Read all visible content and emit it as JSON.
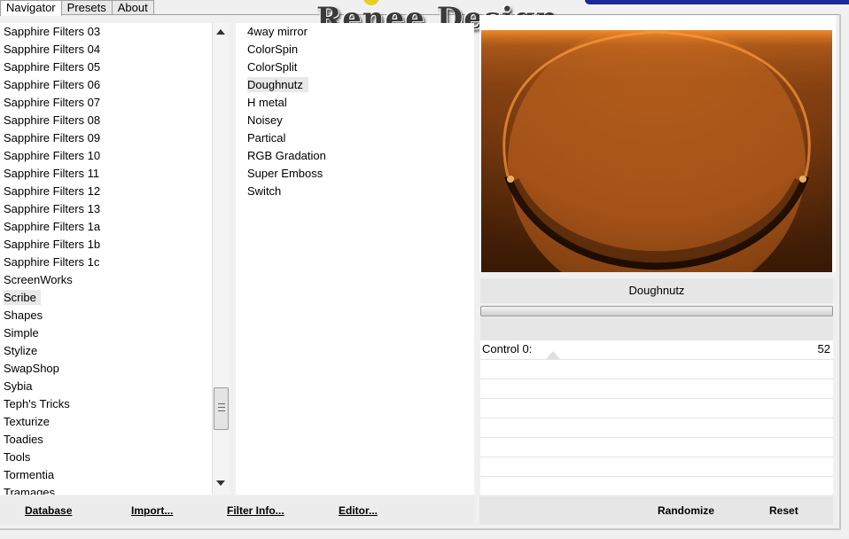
{
  "tabs": [
    {
      "label": "Navigator",
      "active": true
    },
    {
      "label": "Presets",
      "active": false
    },
    {
      "label": "About",
      "active": false
    }
  ],
  "logo_text": "Renee Design",
  "categories": [
    "Sapphire Filters 03",
    "Sapphire Filters 04",
    "Sapphire Filters 05",
    "Sapphire Filters 06",
    "Sapphire Filters 07",
    "Sapphire Filters 08",
    "Sapphire Filters 09",
    "Sapphire Filters 10",
    "Sapphire Filters 11",
    "Sapphire Filters 12",
    "Sapphire Filters 13",
    "Sapphire Filters 1a",
    "Sapphire Filters 1b",
    "Sapphire Filters 1c",
    "ScreenWorks",
    "Scribe",
    "Shapes",
    "Simple",
    "Stylize",
    "SwapShop",
    "Sybia",
    "Teph's Tricks",
    "Texturize",
    "Toadies",
    "Tools",
    "Tormentia",
    "Tramages"
  ],
  "selected_category": "Scribe",
  "filters": [
    "4way mirror",
    "ColorSpin",
    "ColorSplit",
    "Doughnutz",
    "H metal",
    "Noisey",
    "Partical",
    "RGB Gradation",
    "Super Emboss",
    "Switch"
  ],
  "selected_filter": "Doughnutz",
  "preview": {
    "filter_name": "Doughnutz",
    "colors": {
      "orange": "#f07f20",
      "dark": "#1a0a02",
      "mid": "#a8541c"
    }
  },
  "controls": [
    {
      "label": "Control 0:",
      "value": "52"
    }
  ],
  "buttons": {
    "database": "Database",
    "import": "Import...",
    "filter_info": "Filter Info...",
    "editor": "Editor...",
    "randomize": "Randomize",
    "reset": "Reset"
  }
}
